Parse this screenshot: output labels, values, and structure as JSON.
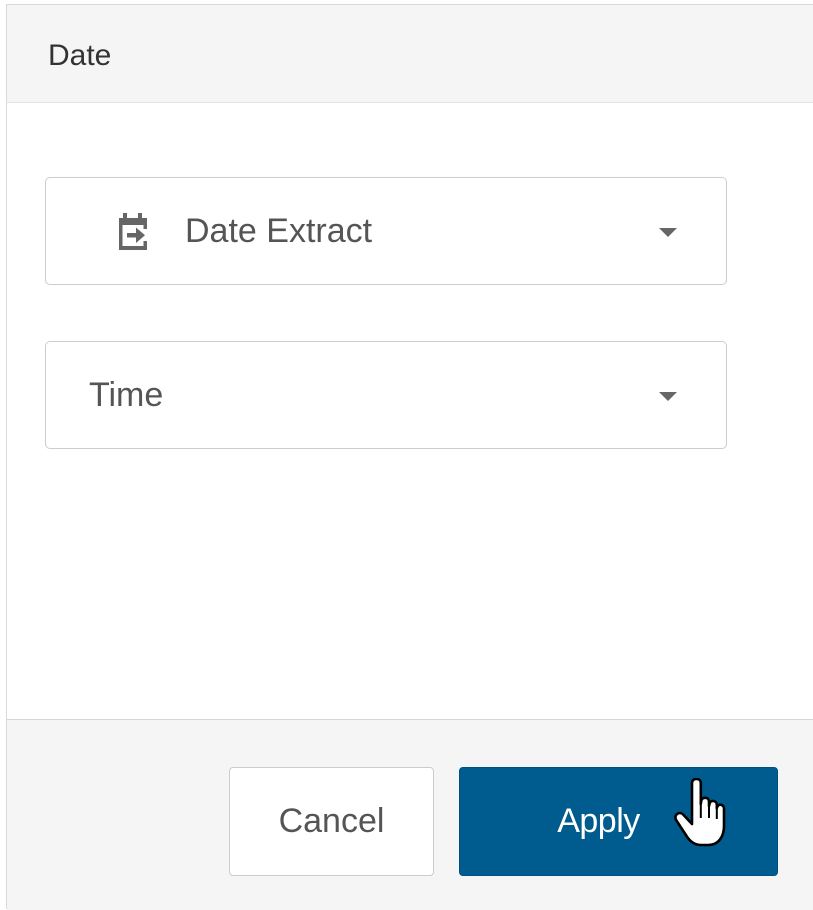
{
  "header": {
    "title": "Date"
  },
  "fields": {
    "date_type": {
      "value": "Date Extract",
      "icon": "calendar-arrow-icon"
    },
    "date_part": {
      "value": "Time"
    }
  },
  "footer": {
    "cancel_label": "Cancel",
    "apply_label": "Apply"
  },
  "colors": {
    "primary": "#005b8f",
    "header_bg": "#f5f5f5",
    "border": "#cccccc"
  }
}
